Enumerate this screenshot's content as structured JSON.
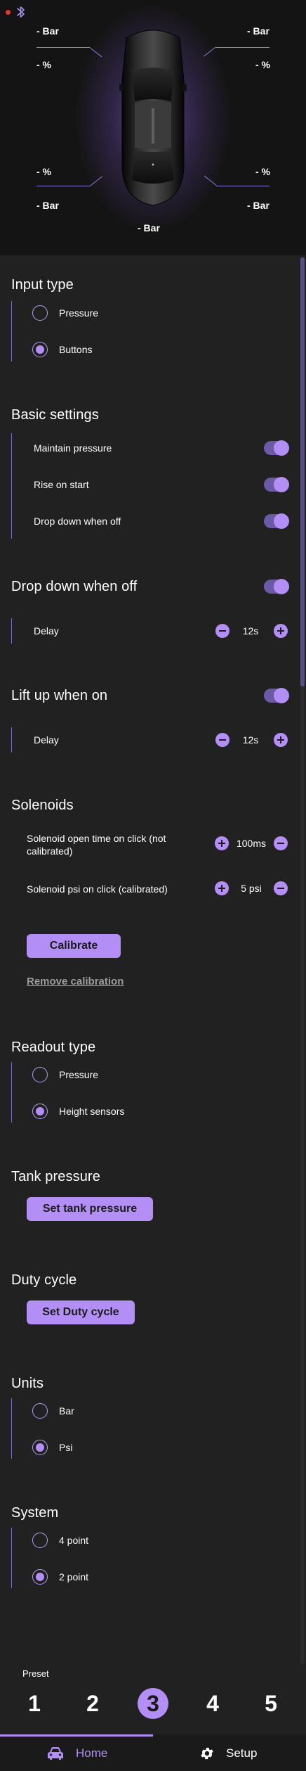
{
  "status": {
    "indicator_color": "#e53935"
  },
  "hero": {
    "fl_bar": "- Bar",
    "fl_pct": "- %",
    "fr_bar": "- Bar",
    "fr_pct": "- %",
    "rl_pct": "- %",
    "rl_bar": "- Bar",
    "rr_pct": "- %",
    "rr_bar": "- Bar",
    "tank_bar": "- Bar"
  },
  "input_type": {
    "title": "Input type",
    "options": [
      {
        "label": "Pressure",
        "selected": false
      },
      {
        "label": "Buttons",
        "selected": true
      }
    ]
  },
  "basic_settings": {
    "title": "Basic settings",
    "items": [
      {
        "label": "Maintain pressure",
        "on": true
      },
      {
        "label": "Rise on start",
        "on": true
      },
      {
        "label": "Drop down when off",
        "on": true
      }
    ]
  },
  "drop_down": {
    "title": "Drop down when off",
    "on": true,
    "delay_label": "Delay",
    "delay_value": "12s"
  },
  "lift_up": {
    "title": "Lift up when on",
    "on": true,
    "delay_label": "Delay",
    "delay_value": "12s"
  },
  "solenoids": {
    "title": "Solenoids",
    "open_time_label": "Solenoid open time on click (not calibrated)",
    "open_time_value": "100ms",
    "psi_label": "Solenoid psi on click (calibrated)",
    "psi_value": "5 psi",
    "calibrate_label": "Calibrate",
    "remove_label": "Remove calibration"
  },
  "readout_type": {
    "title": "Readout type",
    "options": [
      {
        "label": "Pressure",
        "selected": false
      },
      {
        "label": "Height sensors",
        "selected": true
      }
    ]
  },
  "tank_pressure": {
    "title": "Tank pressure",
    "button": "Set tank pressure"
  },
  "duty_cycle": {
    "title": "Duty cycle",
    "button": "Set Duty cycle"
  },
  "units": {
    "title": "Units",
    "options": [
      {
        "label": "Bar",
        "selected": false
      },
      {
        "label": "Psi",
        "selected": true
      }
    ]
  },
  "system": {
    "title": "System",
    "options": [
      {
        "label": "4 point",
        "selected": false
      },
      {
        "label": "2 point",
        "selected": true
      }
    ]
  },
  "preset": {
    "label": "Preset",
    "items": [
      "1",
      "2",
      "3",
      "4",
      "5"
    ],
    "active": "3"
  },
  "nav": {
    "home": "Home",
    "setup": "Setup",
    "active": "home"
  },
  "colors": {
    "accent": "#b38ff5",
    "background": "#212121",
    "hero_background": "#141414"
  }
}
